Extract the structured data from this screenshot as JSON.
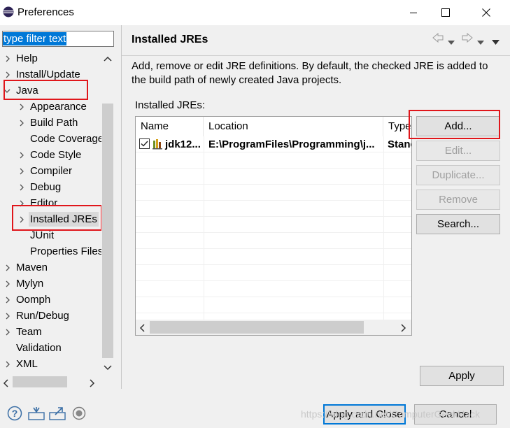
{
  "window": {
    "title": "Preferences"
  },
  "filter": {
    "text": "type filter text"
  },
  "tree": {
    "items": [
      {
        "label": "Help"
      },
      {
        "label": "Install/Update"
      },
      {
        "label": "Java"
      },
      {
        "label": "Appearance"
      },
      {
        "label": "Build Path"
      },
      {
        "label": "Code Coverage"
      },
      {
        "label": "Code Style"
      },
      {
        "label": "Compiler"
      },
      {
        "label": "Debug"
      },
      {
        "label": "Editor"
      },
      {
        "label": "Installed JREs"
      },
      {
        "label": "JUnit"
      },
      {
        "label": "Properties Files"
      },
      {
        "label": "Maven"
      },
      {
        "label": "Mylyn"
      },
      {
        "label": "Oomph"
      },
      {
        "label": "Run/Debug"
      },
      {
        "label": "Team"
      },
      {
        "label": "Validation"
      },
      {
        "label": "XML"
      }
    ]
  },
  "page": {
    "title": "Installed JREs",
    "description": "Add, remove or edit JRE definitions. By default, the checked JRE is added to the build path of newly created Java projects.",
    "jres_label": "Installed JREs:"
  },
  "table": {
    "columns": [
      "Name",
      "Location",
      "Type"
    ],
    "rows": [
      {
        "name": "jdk12...",
        "location": "E:\\ProgramFiles\\Programming\\j...",
        "type": "Stanc",
        "checked": true
      }
    ]
  },
  "buttons": {
    "add": "Add...",
    "edit": "Edit...",
    "duplicate": "Duplicate...",
    "remove": "Remove",
    "search": "Search...",
    "apply": "Apply",
    "apply_close": "Apply and Close",
    "cancel": "Cancel"
  },
  "watermark": "https://blog.csdn.net/ComputerGeekHack",
  "colors": {
    "highlight": "#e0161b",
    "selection": "#0078d7"
  }
}
